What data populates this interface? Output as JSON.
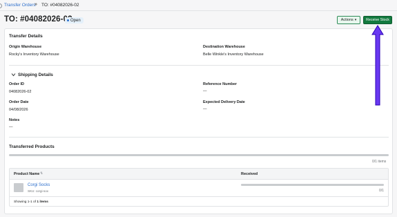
{
  "breadcrumb": {
    "parent_label": "Transfer Orders",
    "separator": "»",
    "current_label": "TO: #04082026-02"
  },
  "header": {
    "title": "TO: #04082026-02",
    "status_badge": "Open",
    "actions_label": "Actions",
    "receive_label": "Receive Stock"
  },
  "colors": {
    "primary_green": "#137a3f",
    "link_blue": "#2c6ecb",
    "annotation_arrow": "#6a39f2"
  },
  "transfer_details": {
    "title": "Transfer Details",
    "origin_label": "Origin Warehouse",
    "origin_value": "Rocky's Inventory Warehouse",
    "destination_label": "Destination Warehouse",
    "destination_value": "Belle Winkle's Inventory Warehouse"
  },
  "shipping_details": {
    "title": "Shipping Details",
    "order_id_label": "Order ID",
    "order_id_value": "04082026-02",
    "reference_label": "Reference Number",
    "reference_value": "—",
    "order_date_label": "Order Date",
    "order_date_value": "04/08/2026",
    "expected_label": "Expected Delivery Date",
    "expected_value": "—",
    "notes_label": "Notes",
    "notes_value": "—"
  },
  "transferred_products": {
    "title": "Transferred Products",
    "progress_fraction": 0,
    "progress_text": "0/1 items",
    "columns": {
      "product_name": "Product Name",
      "received": "Received"
    },
    "rows": [
      {
        "name": "Corgi Socks",
        "sku": "SKU: corgi-sox",
        "received_fraction": 0,
        "received_text": "0/1"
      }
    ],
    "footer_prefix": "Showing 1-1 of",
    "footer_total": "1 items"
  },
  "icons": {
    "sort": "sort-icon",
    "chevron": "chevron-down-icon",
    "caret": "caret-down-icon"
  }
}
